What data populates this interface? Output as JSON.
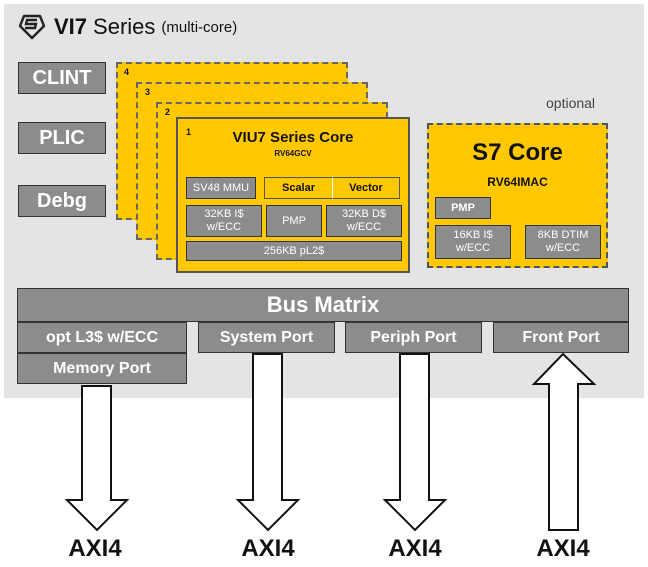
{
  "header": {
    "logo_icon": "sifive-shield-logo",
    "title_bold": "VI7",
    "title_rest": "Series",
    "title_note": "(multi-core)"
  },
  "side_blocks": [
    "CLINT",
    "PLIC",
    "Debg"
  ],
  "core_stack": {
    "instance_numbers": [
      "4",
      "3",
      "2",
      "1"
    ],
    "title": "VIU7 Series Core",
    "isa": "RV64GCV",
    "blocks": {
      "mmu": "SV48 MMU",
      "scalar": "Scalar",
      "vector": "Vector",
      "icache": "32KB I$ w/ECC",
      "pmp": "PMP",
      "dcache": "32KB D$ w/ECC",
      "l2": "256KB pL2$"
    }
  },
  "s7": {
    "optional_label": "optional",
    "title": "S7 Core",
    "isa": "RV64IMAC",
    "pmp": "PMP",
    "icache": "16KB I$ w/ECC",
    "dtim": "8KB DTIM w/ECC"
  },
  "bus": {
    "label": "Bus Matrix",
    "ports": [
      {
        "label": "opt L3$ w/ECC",
        "sub_label": "Memory  Port",
        "direction": "out",
        "interface": "AXI4"
      },
      {
        "label": "System Port",
        "direction": "out",
        "interface": "AXI4"
      },
      {
        "label": "Periph Port",
        "direction": "out",
        "interface": "AXI4"
      },
      {
        "label": "Front Port",
        "direction": "in",
        "interface": "AXI4"
      }
    ]
  },
  "colors": {
    "panel": "#e4e4e4",
    "core_yellow": "#ffc800",
    "block_gray": "#8c8c8c",
    "border_dark": "#333333"
  }
}
